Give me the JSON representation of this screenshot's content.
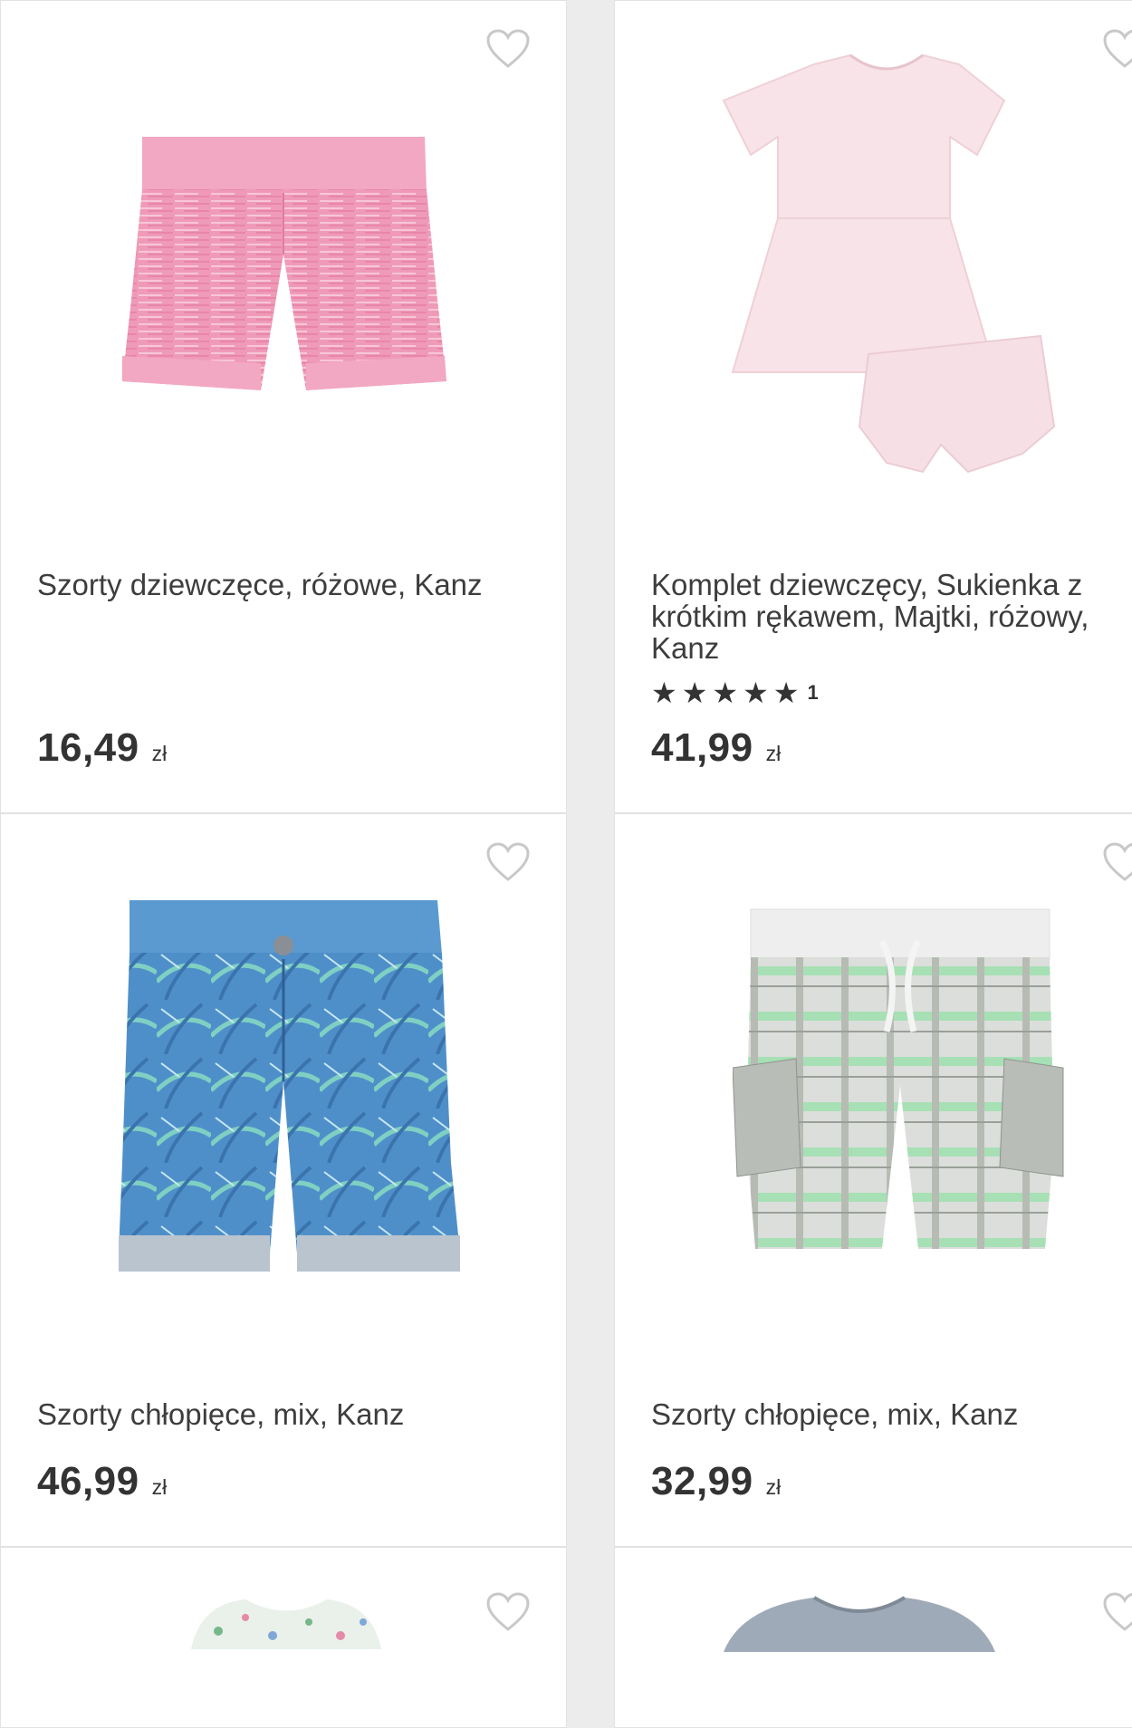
{
  "products": [
    {
      "title": "Szorty dziewczęce, różowe, Kanz",
      "price": "16,49",
      "currency": "zł",
      "image": "pink-shorts"
    },
    {
      "title": "Komplet dziewczęcy, Sukienka z krótkim rękawem, Majtki, różowy, Kanz",
      "price": "41,99",
      "currency": "zł",
      "image": "pink-dress-set",
      "rating_count": "1",
      "rating": 5
    },
    {
      "title": "Szorty chłopięce, mix, Kanz",
      "price": "46,99",
      "currency": "zł",
      "image": "blue-palm-shorts"
    },
    {
      "title": "Szorty chłopięce, mix, Kanz",
      "price": "32,99",
      "currency": "zł",
      "image": "green-cargo-shorts"
    }
  ],
  "icons": {
    "wishlist": "heart-outline-icon",
    "rating": "star-icon"
  },
  "colors": {
    "page_bg": "#ececec",
    "card_bg": "#ffffff",
    "text": "#3d3d3d",
    "heart": "#c8c8c8"
  }
}
